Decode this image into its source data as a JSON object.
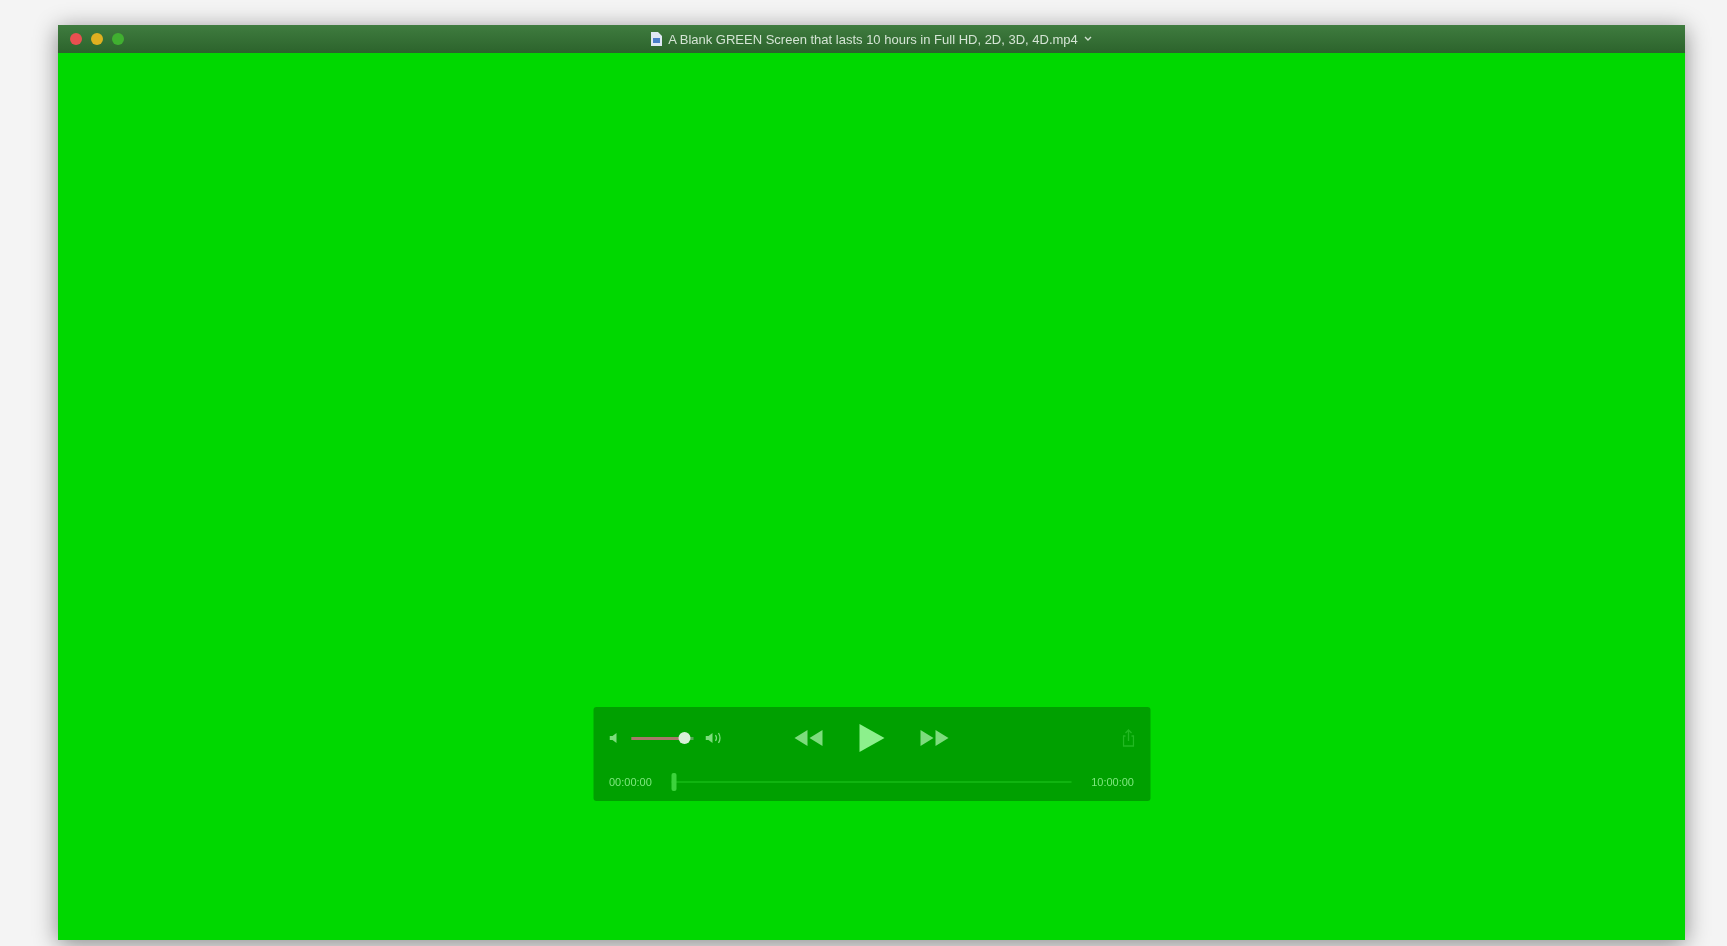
{
  "window": {
    "title": "A Blank GREEN Screen that lasts 10 hours in Full HD, 2D, 3D, 4D.mp4"
  },
  "controls": {
    "volume": {
      "level": 0.95
    },
    "playing": false,
    "progress": {
      "level": 0.0
    },
    "elapsed": "00:00:00",
    "duration": "10:00:00"
  }
}
